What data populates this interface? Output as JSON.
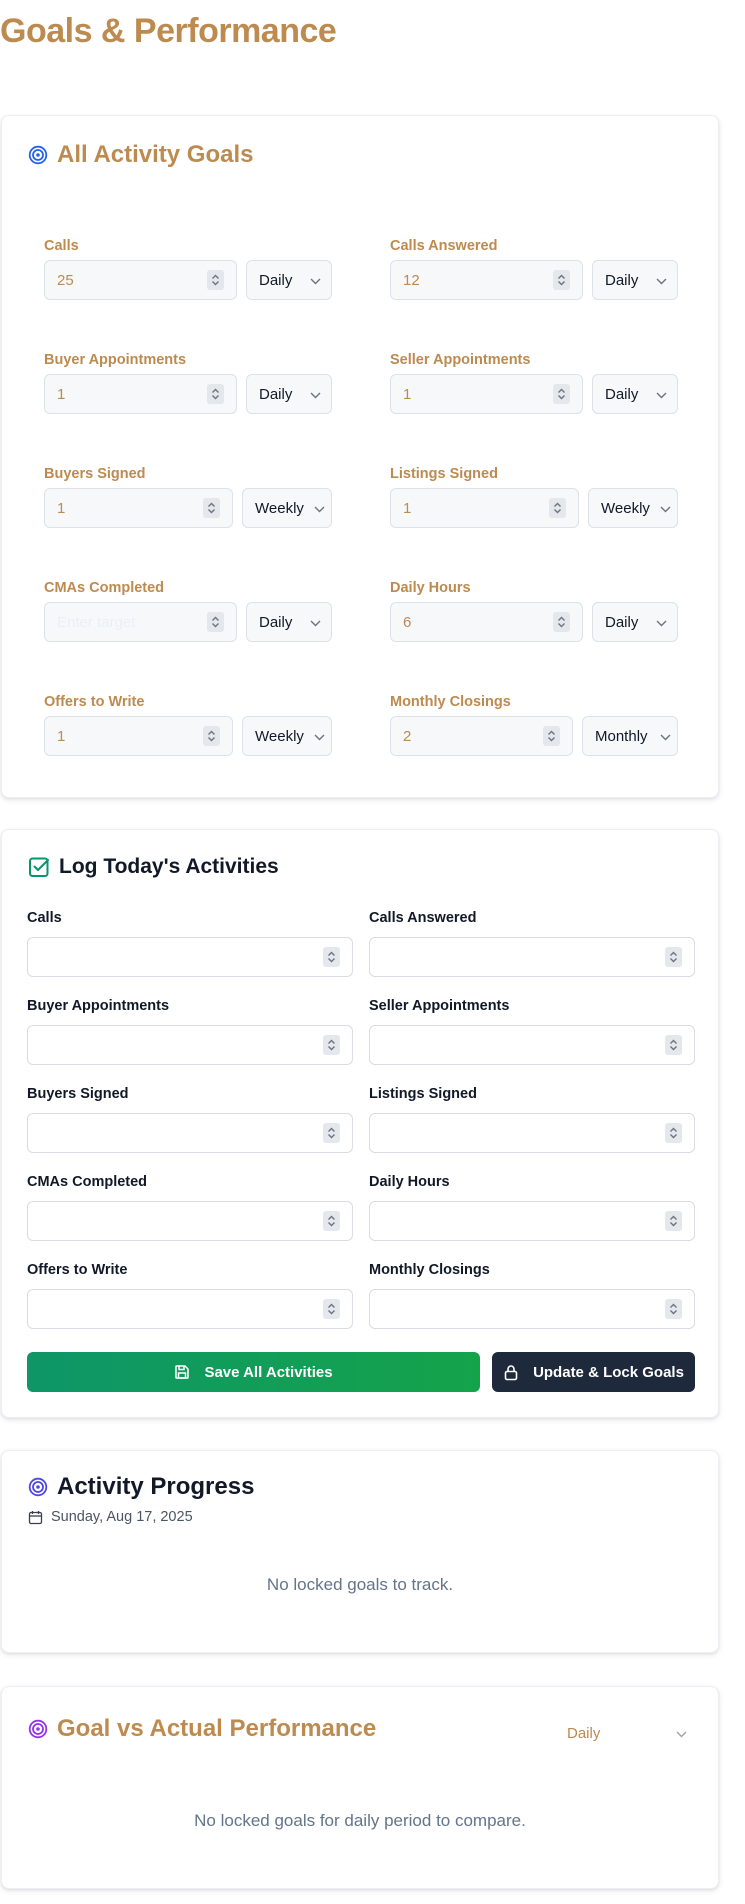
{
  "page": {
    "title": "Goals & Performance"
  },
  "goals_card": {
    "title": "All Activity Goals",
    "items": [
      {
        "label": "Calls",
        "value": "25",
        "placeholder": "",
        "period": "Daily"
      },
      {
        "label": "Calls Answered",
        "value": "12",
        "placeholder": "",
        "period": "Daily"
      },
      {
        "label": "Buyer Appointments",
        "value": "1",
        "placeholder": "",
        "period": "Daily"
      },
      {
        "label": "Seller Appointments",
        "value": "1",
        "placeholder": "",
        "period": "Daily"
      },
      {
        "label": "Buyers Signed",
        "value": "1",
        "placeholder": "",
        "period": "Weekly"
      },
      {
        "label": "Listings Signed",
        "value": "1",
        "placeholder": "",
        "period": "Weekly"
      },
      {
        "label": "CMAs Completed",
        "value": "",
        "placeholder": "Enter target",
        "period": "Daily"
      },
      {
        "label": "Daily Hours",
        "value": "6",
        "placeholder": "",
        "period": "Daily"
      },
      {
        "label": "Offers to Write",
        "value": "1",
        "placeholder": "",
        "period": "Weekly"
      },
      {
        "label": "Monthly Closings",
        "value": "2",
        "placeholder": "",
        "period": "Monthly"
      }
    ]
  },
  "log_card": {
    "title": "Log Today's Activities",
    "fields": [
      {
        "label": "Calls",
        "value": ""
      },
      {
        "label": "Calls Answered",
        "value": ""
      },
      {
        "label": "Buyer Appointments",
        "value": ""
      },
      {
        "label": "Seller Appointments",
        "value": ""
      },
      {
        "label": "Buyers Signed",
        "value": ""
      },
      {
        "label": "Listings Signed",
        "value": ""
      },
      {
        "label": "CMAs Completed",
        "value": ""
      },
      {
        "label": "Daily Hours",
        "value": ""
      },
      {
        "label": "Offers to Write",
        "value": ""
      },
      {
        "label": "Monthly Closings",
        "value": ""
      }
    ],
    "save_label": "Save All Activities",
    "lock_label": "Update & Lock Goals"
  },
  "progress_card": {
    "title": "Activity Progress",
    "date": "Sunday, Aug 17, 2025",
    "empty_message": "No locked goals to track."
  },
  "performance_card": {
    "title": "Goal vs Actual Performance",
    "period": "Daily",
    "empty_message": "No locked goals for daily period to compare."
  },
  "colors": {
    "accent_gold": "#bd8a4f",
    "target_blue": "#2563eb",
    "check_green": "#059669",
    "target_indigo": "#4f46e5",
    "target_purple": "#9333ea",
    "save_green": "#15a34a",
    "lock_dark": "#1e293b"
  },
  "icons": {
    "goals": "target-icon",
    "log": "check-square-icon",
    "progress": "target-icon",
    "date": "calendar-icon",
    "performance": "target-icon",
    "save": "save-icon",
    "lock": "lock-icon",
    "select": "chevron-down-icon",
    "stepper": "spin-arrows-icon"
  }
}
